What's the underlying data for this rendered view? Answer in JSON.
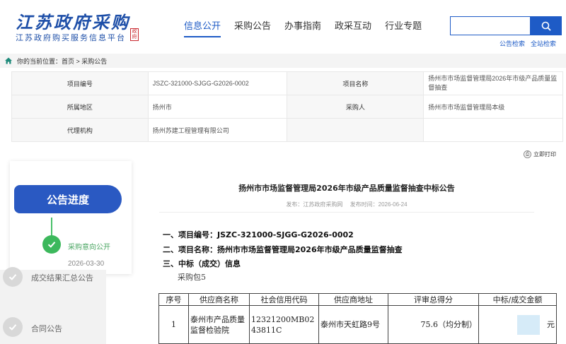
{
  "header": {
    "logo_title": "江苏政府采购",
    "logo_subtitle": "江苏政府购买服务信息平台",
    "logo_seal": "政府",
    "nav": [
      {
        "label": "信息公开",
        "active": true
      },
      {
        "label": "采购公告",
        "active": false
      },
      {
        "label": "办事指南",
        "active": false
      },
      {
        "label": "政采互动",
        "active": false
      },
      {
        "label": "行业专题",
        "active": false
      }
    ],
    "search": {
      "placeholder": "",
      "icon": "search-icon"
    },
    "search_links": [
      "公告检索",
      "全站检索"
    ]
  },
  "breadcrumb": "你的当前位置：首页 > 采购公告",
  "info_table": {
    "rows": [
      {
        "label_a": "项目编号",
        "value_a": "JSZC-321000-SJGG-G2026-0002",
        "label_b": "项目名称",
        "value_b": "扬州市市场监督管理局2026年市级产品质量监督抽查"
      },
      {
        "label_a": "所属地区",
        "value_a": "扬州市",
        "label_b": "采购人",
        "value_b": "扬州市市场监督管理局本级"
      },
      {
        "label_a": "代理机构",
        "value_a": "扬州苏建工程管理有限公司",
        "label_b": "",
        "value_b": ""
      }
    ]
  },
  "print_label": "立即打印",
  "sidebar": {
    "title": "公告进度",
    "steps": [
      {
        "label": "采购意向公开",
        "date": "2026-03-30",
        "done": true
      },
      {
        "label": "成交结果汇总公告",
        "done": false
      },
      {
        "label": "合同公告",
        "done": false
      }
    ]
  },
  "article": {
    "title": "扬州市市场监督管理局2026年市级产品质量监督抽查中标公告",
    "publisher": "发布：江苏政府采购网",
    "publish_time": "发布时间：2026-06-24",
    "sections": [
      "一、项目编号：JSZC-321000-SJGG-G2026-0002",
      "二、项目名称：扬州市市场监督管理局2026年市级产品质量监督抽查",
      "三、中标（成交）信息"
    ],
    "package": "采购包5",
    "result_table": {
      "headers": [
        "序号",
        "供应商名称",
        "社会信用代码",
        "供应商地址",
        "评审总得分",
        "中标/成交金额"
      ],
      "rows": [
        [
          "1",
          "泰州市产品质量监督检验院",
          "12321200MB0243811C",
          "泰州市天虹路9号",
          "75.6（均分制）",
          "元"
        ]
      ]
    }
  },
  "colors": {
    "brand_blue": "#1e5bc6",
    "progress_green": "#3cb85c",
    "sidebar_title_bg": "#2a59c2"
  }
}
